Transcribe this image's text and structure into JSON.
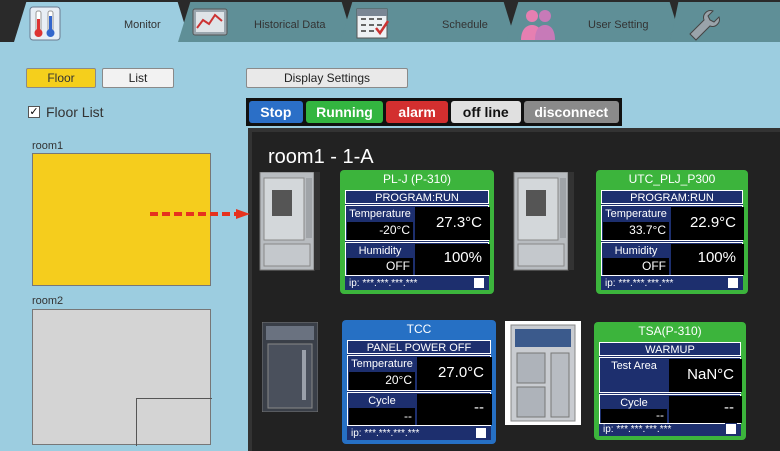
{
  "tabs": [
    {
      "label": "Monitor",
      "icon": "thermometer-icon"
    },
    {
      "label": "Historical Data",
      "icon": "graph-monitor-icon"
    },
    {
      "label": "Schedule",
      "icon": "calendar-icon"
    },
    {
      "label": "User Setting",
      "icon": "users-icon"
    },
    {
      "label": "",
      "icon": "wrench-icon"
    }
  ],
  "view_buttons": {
    "floor": "Floor",
    "list": "List"
  },
  "display_settings": "Display Settings",
  "floor_list": {
    "label": "Floor List",
    "checked": true,
    "check_mark": "✓"
  },
  "rooms": [
    {
      "label": "room1",
      "color": "#f5cd1d"
    },
    {
      "label": "room2",
      "color": "#d4d4d4"
    }
  ],
  "legend": [
    {
      "label": "Stop",
      "color": "#2b6fc7"
    },
    {
      "label": "Running",
      "color": "#33b540"
    },
    {
      "label": "alarm",
      "color": "#d32f2f"
    },
    {
      "label": "off line",
      "color": "#e0e0e0"
    },
    {
      "label": "disconnect",
      "color": "#8a8a8a"
    }
  ],
  "room_title": "room1 - 1-A",
  "devices": [
    {
      "name": "PL-J (P-310)",
      "status": "PROGRAM:RUN",
      "label1": "Temperature",
      "sub1": "-20°C",
      "val1": "27.3°C",
      "label2": "Humidity",
      "sub2": "OFF",
      "val2": "100%",
      "ip": "ip: ***.***.***.***"
    },
    {
      "name": "UTC_PLJ_P300",
      "status": "PROGRAM:RUN",
      "label1": "Temperature",
      "sub1": "33.7°C",
      "val1": "22.9°C",
      "label2": "Humidity",
      "sub2": "OFF",
      "val2": "100%",
      "ip": "ip: ***.***.***.***"
    },
    {
      "name": "TCC",
      "status": "PANEL POWER OFF",
      "label1": "Temperature",
      "sub1": "20°C",
      "val1": "27.0°C",
      "label2": "Cycle",
      "sub2": "--",
      "val2": "--",
      "ip": "ip: ***.***.***.***"
    },
    {
      "name": "TSA(P-310)",
      "status": "WARMUP",
      "label1": "Test Area",
      "sub1": "",
      "val1": "NaN°C",
      "label2": "Cycle",
      "sub2": "--",
      "val2": "--",
      "ip": "ip: ***.***.***.***"
    }
  ]
}
